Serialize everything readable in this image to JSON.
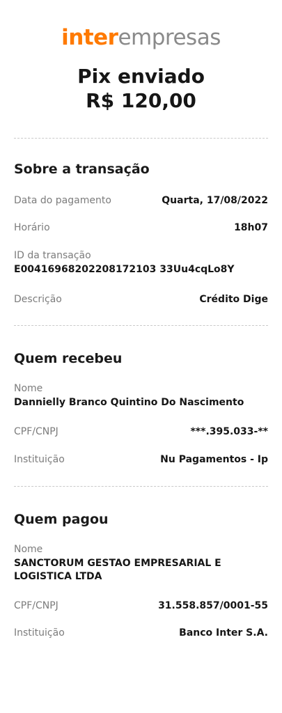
{
  "logo": {
    "brand": "inter",
    "sub": "empresas"
  },
  "header": {
    "title": "Pix enviado",
    "amount": "R$ 120,00"
  },
  "transacao": {
    "title": "Sobre a transação",
    "data_label": "Data do pagamento",
    "data_value": "Quarta, 17/08/2022",
    "horario_label": "Horário",
    "horario_value": "18h07",
    "id_label": "ID da transação",
    "id_value": "E00416968202208172103 33Uu4cqLo8Y",
    "descricao_label": "Descrição",
    "descricao_value": "Crédito Dige"
  },
  "recebeu": {
    "title": "Quem recebeu",
    "nome_label": "Nome",
    "nome_value": "Dannielly Branco Quintino Do Nascimento",
    "cpf_label": "CPF/CNPJ",
    "cpf_value": "***.395.033-**",
    "inst_label": "Instituição",
    "inst_value": "Nu Pagamentos - Ip"
  },
  "pagou": {
    "title": "Quem pagou",
    "nome_label": "Nome",
    "nome_value": "SANCTORUM GESTAO EMPRESARIAL E LOGISTICA LTDA",
    "cpf_label": "CPF/CNPJ",
    "cpf_value": "31.558.857/0001-55",
    "inst_label": "Instituição",
    "inst_value": "Banco Inter S.A."
  },
  "colors": {
    "brand": "#ff7a00",
    "text": "#161616",
    "muted": "#7c7c7c",
    "divider": "#c9c9c9"
  }
}
